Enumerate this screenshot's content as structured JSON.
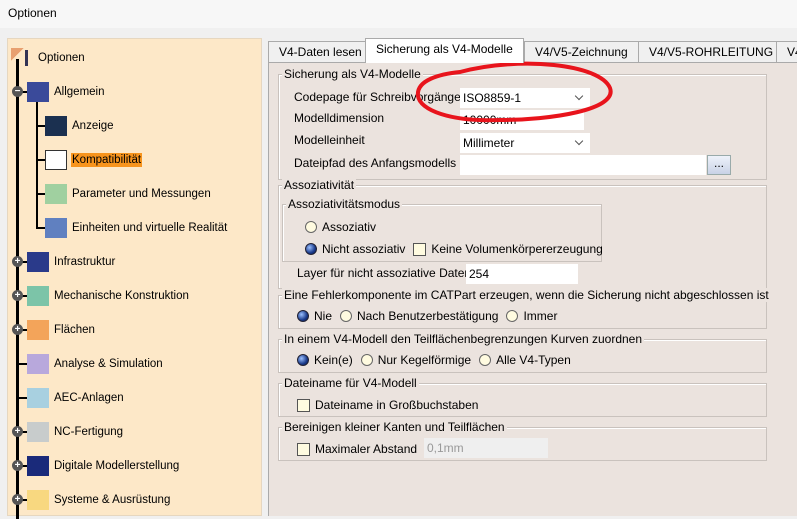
{
  "window": {
    "title": "Optionen"
  },
  "tree": {
    "root": "Optionen",
    "items": [
      {
        "label": "Allgemein",
        "level": 0,
        "expander": "minus"
      },
      {
        "label": "Anzeige",
        "level": 1
      },
      {
        "label": "Kompatibilität",
        "level": 1,
        "selected": true
      },
      {
        "label": "Parameter und Messungen",
        "level": 1
      },
      {
        "label": "Einheiten und virtuelle Realität",
        "level": 1
      },
      {
        "label": "Infrastruktur",
        "level": 0,
        "expander": "plus"
      },
      {
        "label": "Mechanische Konstruktion",
        "level": 0,
        "expander": "plus"
      },
      {
        "label": "Flächen",
        "level": 0,
        "expander": "plus"
      },
      {
        "label": "Analyse & Simulation",
        "level": 0
      },
      {
        "label": "AEC-Anlagen",
        "level": 0
      },
      {
        "label": "NC-Fertigung",
        "level": 0,
        "expander": "plus"
      },
      {
        "label": "Digitale Modellerstellung",
        "level": 0,
        "expander": "plus"
      },
      {
        "label": "Systeme & Ausrüstung",
        "level": 0,
        "expander": "plus"
      }
    ],
    "selected_color": "#f7941d"
  },
  "tabs": [
    "V4-Daten lesen",
    "Sicherung als V4-Modelle",
    "V4/V5-Zeichnung",
    "V4/V5-ROHRLEITUNG",
    "V4"
  ],
  "save": {
    "title": "Sicherung als V4-Modelle",
    "codepage_label": "Codepage für Schreibvorgänge",
    "codepage_value": "ISO8859-1",
    "dimension_label": "Modelldimension",
    "dimension_value": "10000mm",
    "unit_label": "Modelleinheit",
    "unit_value": "Millimeter",
    "path_label": "Dateipfad des Anfangsmodells",
    "path_value": "",
    "browse": "..."
  },
  "assoc": {
    "title": "Assoziativität",
    "mode_title": "Assoziativitätsmodus",
    "opt_assoc": "Assoziativ",
    "opt_nonassoc": "Nicht assoziativ",
    "no_solid": "Keine Volumenkörpererzeugung",
    "layer_label": "Layer für nicht assoziative Daten",
    "layer_value": "254"
  },
  "error": {
    "title": "Eine Fehlerkomponente im CATPart erzeugen, wenn die Sicherung nicht abgeschlossen ist",
    "opts": [
      "Nie",
      "Nach Benutzerbestätigung",
      "Immer"
    ]
  },
  "curves": {
    "title": "In einem V4-Modell den Teilflächenbegrenzungen Kurven zuordnen",
    "opts": [
      "Kein(e)",
      "Nur Kegelförmige",
      "Alle V4-Typen"
    ]
  },
  "filename": {
    "title": "Dateiname für V4-Modell",
    "upper": "Dateiname in Großbuchstaben"
  },
  "cleanup": {
    "title": "Bereinigen kleiner Kanten und Teilflächen",
    "max_label": "Maximaler Abstand",
    "max_value": "0,1mm"
  },
  "annotation_color": "#e8141c"
}
